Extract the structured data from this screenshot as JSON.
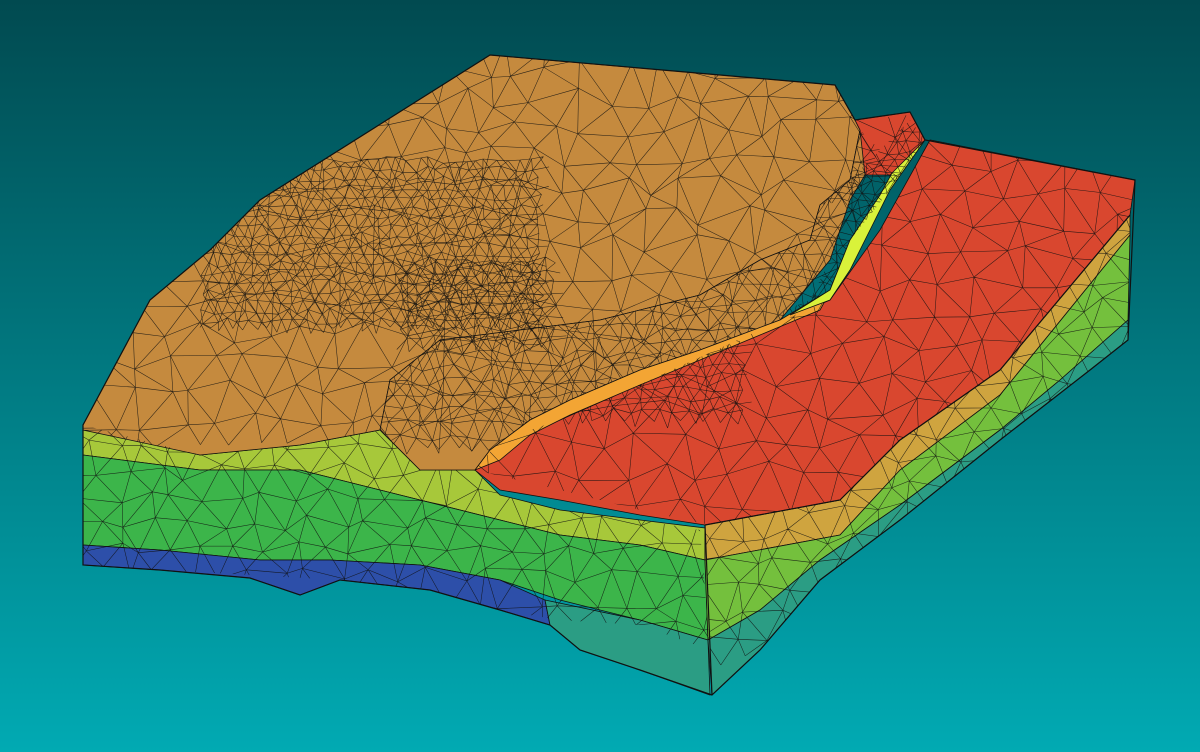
{
  "scene": {
    "kind": "3d-tetrahedral-mesh-block",
    "background": {
      "top": "#014a50",
      "bottom": "#01aab3"
    },
    "mesh": {
      "edge_color": "#111111",
      "materials": {
        "top_surface": "#c58a3e",
        "ridge_band": "#f3a534",
        "fault_band": "#d9f23a",
        "red_block": "#d9472f",
        "ochre_layer": "#cfa43f",
        "yellow_green_layer": "#a7c83a",
        "green_layer": "#3cb54a",
        "lime_layer": "#74c03d",
        "blue_layer": "#2d4fa9",
        "teal_layer": "#2b9d84"
      }
    }
  }
}
